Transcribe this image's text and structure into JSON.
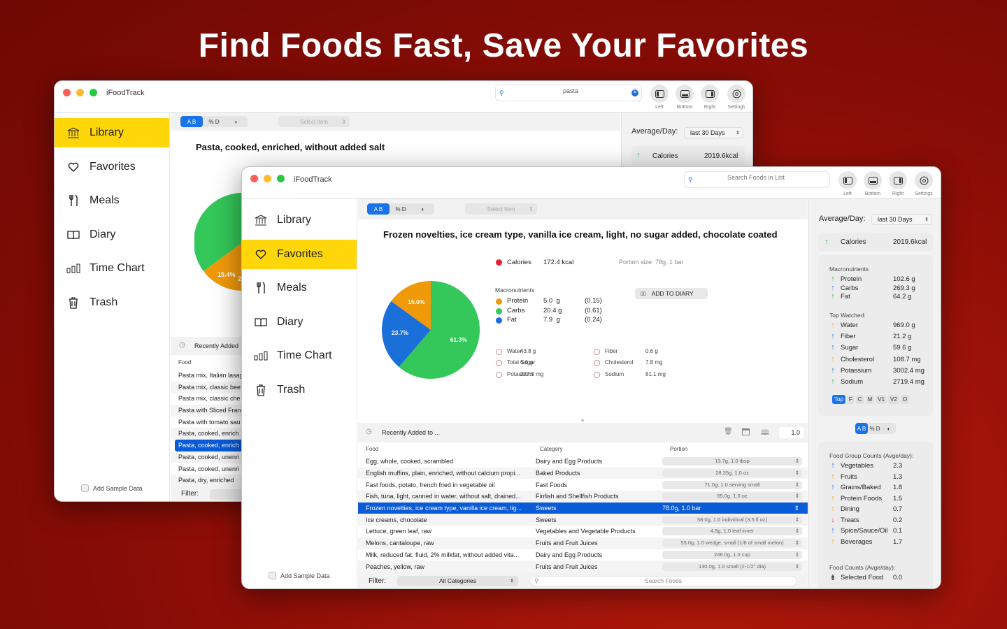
{
  "headline": "Find Foods Fast, Save Your Favorites",
  "colors": {
    "accent_yellow": "#ffd60a",
    "selection_blue": "#0a5bd8",
    "protein": "#f09a0a",
    "carbs": "#34c759",
    "fat": "#1a6fd8",
    "calories": "#e8202a"
  },
  "back_window": {
    "app_title": "iFoodTrack",
    "search": {
      "value": "pasta",
      "icon": "search-icon"
    },
    "toolbar": [
      {
        "label": "Left",
        "icon": "sidebar-left-icon"
      },
      {
        "label": "Bottom",
        "icon": "panel-bottom-icon"
      },
      {
        "label": "Right",
        "icon": "sidebar-right-icon"
      },
      {
        "label": "Settings",
        "icon": "gear-icon"
      }
    ],
    "sidebar": [
      {
        "label": "Library",
        "icon": "building-columns-icon",
        "selected": true
      },
      {
        "label": "Favorites",
        "icon": "heart-icon"
      },
      {
        "label": "Meals",
        "icon": "fork-knife-icon"
      },
      {
        "label": "Diary",
        "icon": "book-icon"
      },
      {
        "label": "Time Chart",
        "icon": "bar-chart-icon"
      },
      {
        "label": "Trash",
        "icon": "trash-icon"
      }
    ],
    "add_sample": "Add Sample Data",
    "seg": [
      "A B",
      "% D",
      "◐"
    ],
    "select_item": "Select Item",
    "food_title": "Pasta, cooked, enriched, without added salt",
    "pie_label": "15.4%",
    "pie_label_partial": "2",
    "average_label": "Average/Day:",
    "period": "last 30 Days",
    "calories_label": "Calories",
    "calories_value": "2019.6kcal",
    "recent_label": "Recently Added",
    "food_col": "Food",
    "rows": [
      "Pasta mix, Italian lasag",
      "Pasta mix, classic bee",
      "Pasta mix, classic che",
      "Pasta with Sliced Fran",
      "Pasta with tomato sau",
      "Pasta, cooked, enrich",
      "Pasta, cooked, enrich",
      "Pasta, cooked, unenri",
      "Pasta, cooked, unenri",
      "Pasta, dry, enriched"
    ],
    "selected_row": 6,
    "filter_label": "Filter:"
  },
  "front_window": {
    "app_title": "iFoodTrack",
    "search_placeholder": "Search Foods in List",
    "toolbar": [
      {
        "label": "Left",
        "icon": "sidebar-left-icon"
      },
      {
        "label": "Bottom",
        "icon": "panel-bottom-icon"
      },
      {
        "label": "Right",
        "icon": "sidebar-right-icon"
      },
      {
        "label": "Settings",
        "icon": "gear-icon"
      }
    ],
    "sidebar": [
      {
        "label": "Library",
        "icon": "building-columns-icon"
      },
      {
        "label": "Favorites",
        "icon": "heart-icon",
        "selected": true
      },
      {
        "label": "Meals",
        "icon": "fork-knife-icon"
      },
      {
        "label": "Diary",
        "icon": "book-icon"
      },
      {
        "label": "Time Chart",
        "icon": "bar-chart-icon"
      },
      {
        "label": "Trash",
        "icon": "trash-icon"
      }
    ],
    "add_sample": "Add Sample Data",
    "seg": [
      "A B",
      "% D",
      "◐"
    ],
    "select_item": "Select Item",
    "food_title": "Frozen novelties, ice cream type, vanilla ice cream, light, no sugar added, chocolate coated",
    "calories_label": "Calories",
    "calories_value": "172.4 kcal",
    "portion_size": "Portion size: 78g, 1 bar",
    "macros_label": "Macronutrients",
    "add_to_diary": "ADD TO DIARY",
    "macros": [
      {
        "name": "Protein",
        "amount": "5.0  g",
        "ratio": "(0.15)"
      },
      {
        "name": "Carbs",
        "amount": "20.4 g",
        "ratio": "(0.61)"
      },
      {
        "name": "Fat",
        "amount": "7.9  g",
        "ratio": "(0.24)"
      }
    ],
    "pie": [
      {
        "name": "Carbs",
        "value": 61.3,
        "label": "61.3%"
      },
      {
        "name": "Fat",
        "value": 23.7,
        "label": "23.7%"
      },
      {
        "name": "Protein",
        "value": 15.0,
        "label": "15.0%"
      }
    ],
    "nutrients_left": [
      {
        "name": "Water",
        "value": "43.8 g"
      },
      {
        "name": "Total Sugar",
        "value": "6.6 g"
      },
      {
        "name": "Potassium",
        "value": "237.9 mg"
      }
    ],
    "nutrients_right": [
      {
        "name": "Fiber",
        "value": "0.6 g"
      },
      {
        "name": "Cholesterol",
        "value": "7.8 mg"
      },
      {
        "name": "Sodium",
        "value": "81.1 mg"
      }
    ],
    "recent_label": "Recently Added to ...",
    "quantity": "1.0",
    "columns": [
      "Food",
      "Category",
      "Portion"
    ],
    "rows": [
      {
        "food": "Egg, whole, cooked, scrambled",
        "category": "Dairy and Egg Products",
        "portion": "13.7g, 1.0 tbsp"
      },
      {
        "food": "English muffins, plain, enriched, without calcium propi...",
        "category": "Baked Products",
        "portion": "28.35g, 1.0 oz"
      },
      {
        "food": "Fast foods, potato, french fried in vegetable oil",
        "category": "Fast Foods",
        "portion": "71.0g, 1.0 serving small"
      },
      {
        "food": "Fish, tuna, light, canned in water, without salt, drained...",
        "category": "Finfish and Shellfish Products",
        "portion": "85.0g, 1.0 oz"
      },
      {
        "food": "Frozen novelties, ice cream type, vanilla ice cream, lig...",
        "category": "Sweets",
        "portion": "78.0g, 1.0 bar"
      },
      {
        "food": "Ice creams, chocolate",
        "category": "Sweets",
        "portion": "58.0g, 1.0 individual (3.5 fl oz)"
      },
      {
        "food": "Lettuce, green leaf, raw",
        "category": "Vegetables and Vegetable Products",
        "portion": "4.8g, 1.0 leaf inner"
      },
      {
        "food": "Melons, cantaloupe, raw",
        "category": "Fruits and Fruit Juices",
        "portion": "55.0g, 1.0 wedge, small (1/8 of small melon)"
      },
      {
        "food": "Milk, reduced fat, fluid, 2% milkfat, without added vita...",
        "category": "Dairy and Egg Products",
        "portion": "246.0g, 1.0 cup"
      },
      {
        "food": "Peaches, yellow, raw",
        "category": "Fruits and Fruit Juices",
        "portion": "130.0g, 1.0 small (2-1/2\" dia)"
      }
    ],
    "selected_row": 4,
    "filter_label": "Filter:",
    "filter_value": "All Categories",
    "search_foods": "Search Foods",
    "right_panel": {
      "average_label": "Average/Day:",
      "period": "last 30 Days",
      "calories_label": "Calories",
      "calories_value": "2019.6kcal",
      "macros_title": "Macronutrients",
      "macros": [
        {
          "name": "Protein",
          "value": "102.6 g",
          "arrow": "up-g"
        },
        {
          "name": "Carbs",
          "value": "269.3 g",
          "arrow": "up-b"
        },
        {
          "name": "Fat",
          "value": "64.2 g",
          "arrow": "up-g"
        }
      ],
      "watched_title": "Top Watched:",
      "watched": [
        {
          "name": "Water",
          "value": "969.0 g",
          "arrow": "up-y"
        },
        {
          "name": "Fiber",
          "value": "21.2 g",
          "arrow": "up-b"
        },
        {
          "name": "Sugar",
          "value": "59.6 g",
          "arrow": "up-b"
        },
        {
          "name": "Cholesterol",
          "value": "108.7 mg",
          "arrow": "up-y"
        },
        {
          "name": "Potassium",
          "value": "3002.4 mg",
          "arrow": "up-b"
        },
        {
          "name": "Sodium",
          "value": "2719.4 mg",
          "arrow": "up-g"
        }
      ],
      "watched_tabs": [
        "Top",
        "F",
        "C",
        "M",
        "V1",
        "V2",
        "O"
      ],
      "seg": [
        "A B",
        "% D",
        "◐"
      ],
      "group_title": "Food Group Counts (Avge/day):",
      "groups": [
        {
          "name": "Vegetables",
          "value": "2.3",
          "arrow": "up-b"
        },
        {
          "name": "Fruits",
          "value": "1.3",
          "arrow": "up-y"
        },
        {
          "name": "Grains/Baked",
          "value": "1.8",
          "arrow": "up-b"
        },
        {
          "name": "Protein Foods",
          "value": "1.5",
          "arrow": "up-y"
        },
        {
          "name": "Dining",
          "value": "0.7",
          "arrow": "up-y"
        },
        {
          "name": "Treats",
          "value": "0.2",
          "arrow": "dn-r"
        },
        {
          "name": "Spice/Sauce/Oil",
          "value": "0.1",
          "arrow": "up-b"
        },
        {
          "name": "Beverages",
          "value": "1.7",
          "arrow": "up-y"
        }
      ],
      "counts_title": "Food Counts (Avge/day):",
      "counts": [
        {
          "name": "Selected Food",
          "value": "0.0"
        }
      ]
    }
  }
}
